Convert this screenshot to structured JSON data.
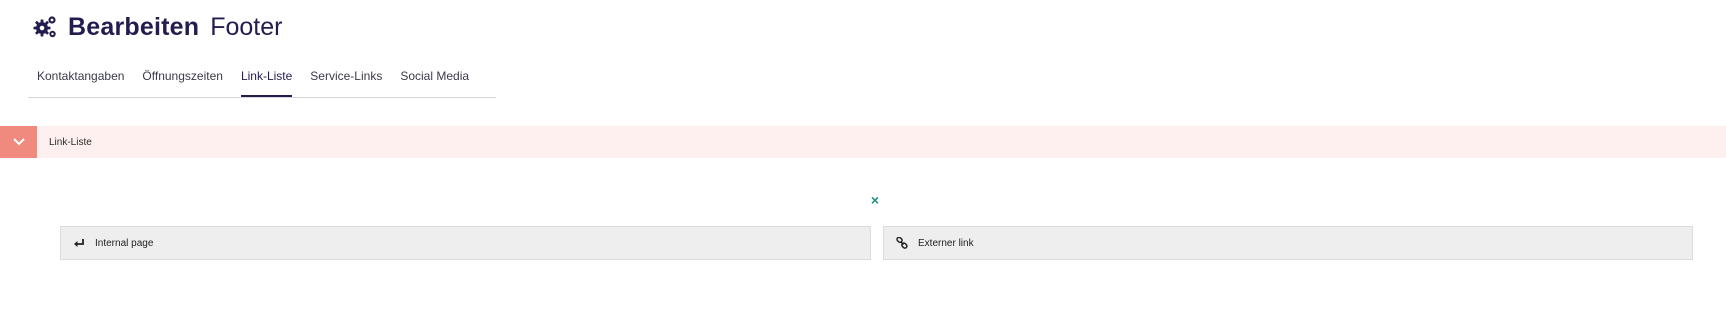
{
  "header": {
    "icon": "gears-icon",
    "title_strong": "Bearbeiten",
    "title_light": "Footer"
  },
  "tabs": [
    {
      "label": "Kontaktangaben",
      "active": false
    },
    {
      "label": "Öffnungszeiten",
      "active": false
    },
    {
      "label": "Link-Liste",
      "active": true
    },
    {
      "label": "Service-Links",
      "active": false
    },
    {
      "label": "Social Media",
      "active": false
    }
  ],
  "accordion": {
    "label": "Link-Liste",
    "toggle_icon": "chevron-down-icon"
  },
  "remove": {
    "icon": "close-icon",
    "symbol": "×"
  },
  "choices": {
    "internal": {
      "label": "Internal page",
      "icon": "enter-arrow-icon"
    },
    "external": {
      "label": "Externer link",
      "icon": "link-icon"
    }
  },
  "colors": {
    "brand": "#231c4f",
    "accordion_bg": "#fdf0ee",
    "accordion_toggle": "#f08a7e",
    "remove": "#1f8b88",
    "choice_bg": "#eeeeee"
  }
}
